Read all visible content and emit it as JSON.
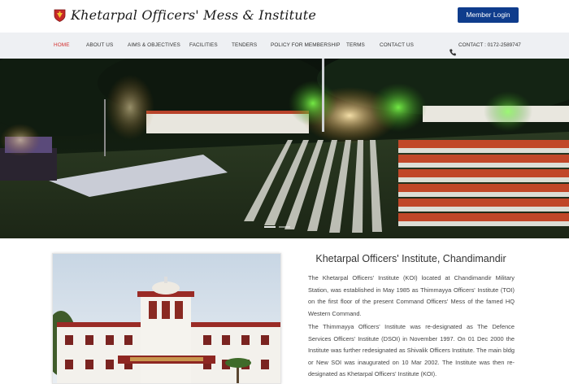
{
  "header": {
    "logo_text": "Khetarpal Officers' Mess & Institute",
    "member_login_label": "Member Login"
  },
  "nav": {
    "items": [
      {
        "label": "HOME"
      },
      {
        "label": "ABOUT US"
      },
      {
        "label": "AIMS & OBJECTIVES"
      },
      {
        "label": "FACILITIES"
      },
      {
        "label": "TENDERS"
      },
      {
        "label": "POLICY FOR MEMBERSHIP"
      },
      {
        "label": "TERMS"
      },
      {
        "label": "CONTACT US"
      }
    ],
    "active_index": 0,
    "contact_text": "CONTACT : 0172-2589747",
    "contact_icon": "phone-icon"
  },
  "hero": {
    "slides_count": 2,
    "active_slide": 0
  },
  "about": {
    "heading": "Khetarpal Officers' Institute, Chandimandir",
    "paragraphs": [
      "The Khetarpal Officers' Institute (KOI) located at Chandimandir Military Station, was established in May 1985 as Thimmayya Officers' Institute (TOI) on the first floor of the present Command Officers' Mess of the famed HQ Western Command.",
      "The Thimmayya Officers' Institute was re-designated as The Defence Services Officers' Institute (DSOI) in November 1997. On 01 Dec 2000 the Institute was further redesignated as Shivalik Officers Institute. The main bldg or New SOI was inaugurated on 10 Mar 2002. The Institute was then re-designated as Khetarpal Officers' Institute (KOI)."
    ]
  },
  "colors": {
    "brand_blue": "#0f3c8c",
    "active_nav": "#d32f2f",
    "nav_bg": "#eef0f3"
  }
}
